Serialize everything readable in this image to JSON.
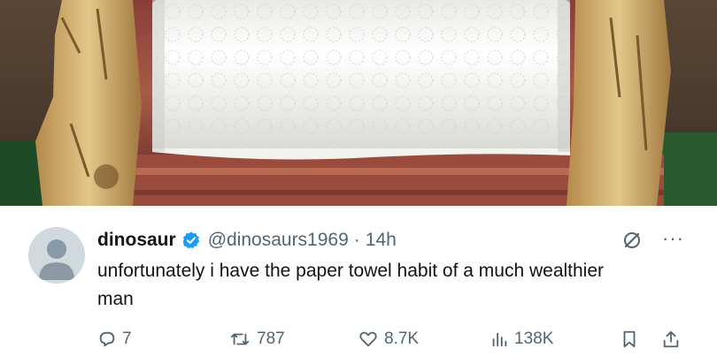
{
  "photo": {
    "icon": "paper-towel-holder-photo"
  },
  "tweet": {
    "display_name": "dinosaur",
    "handle": "@dinosaurs1969",
    "separator": "·",
    "time": "14h",
    "text": "unfortunately i have the paper towel habit of a much wealthier man",
    "more_label": "···"
  },
  "actions": {
    "replies": "7",
    "retweets": "787",
    "likes": "8.7K",
    "views": "138K"
  },
  "colors": {
    "verified": "#1d9bf0",
    "secondary_text": "#536471",
    "avatar_bg": "#cfd9de"
  }
}
